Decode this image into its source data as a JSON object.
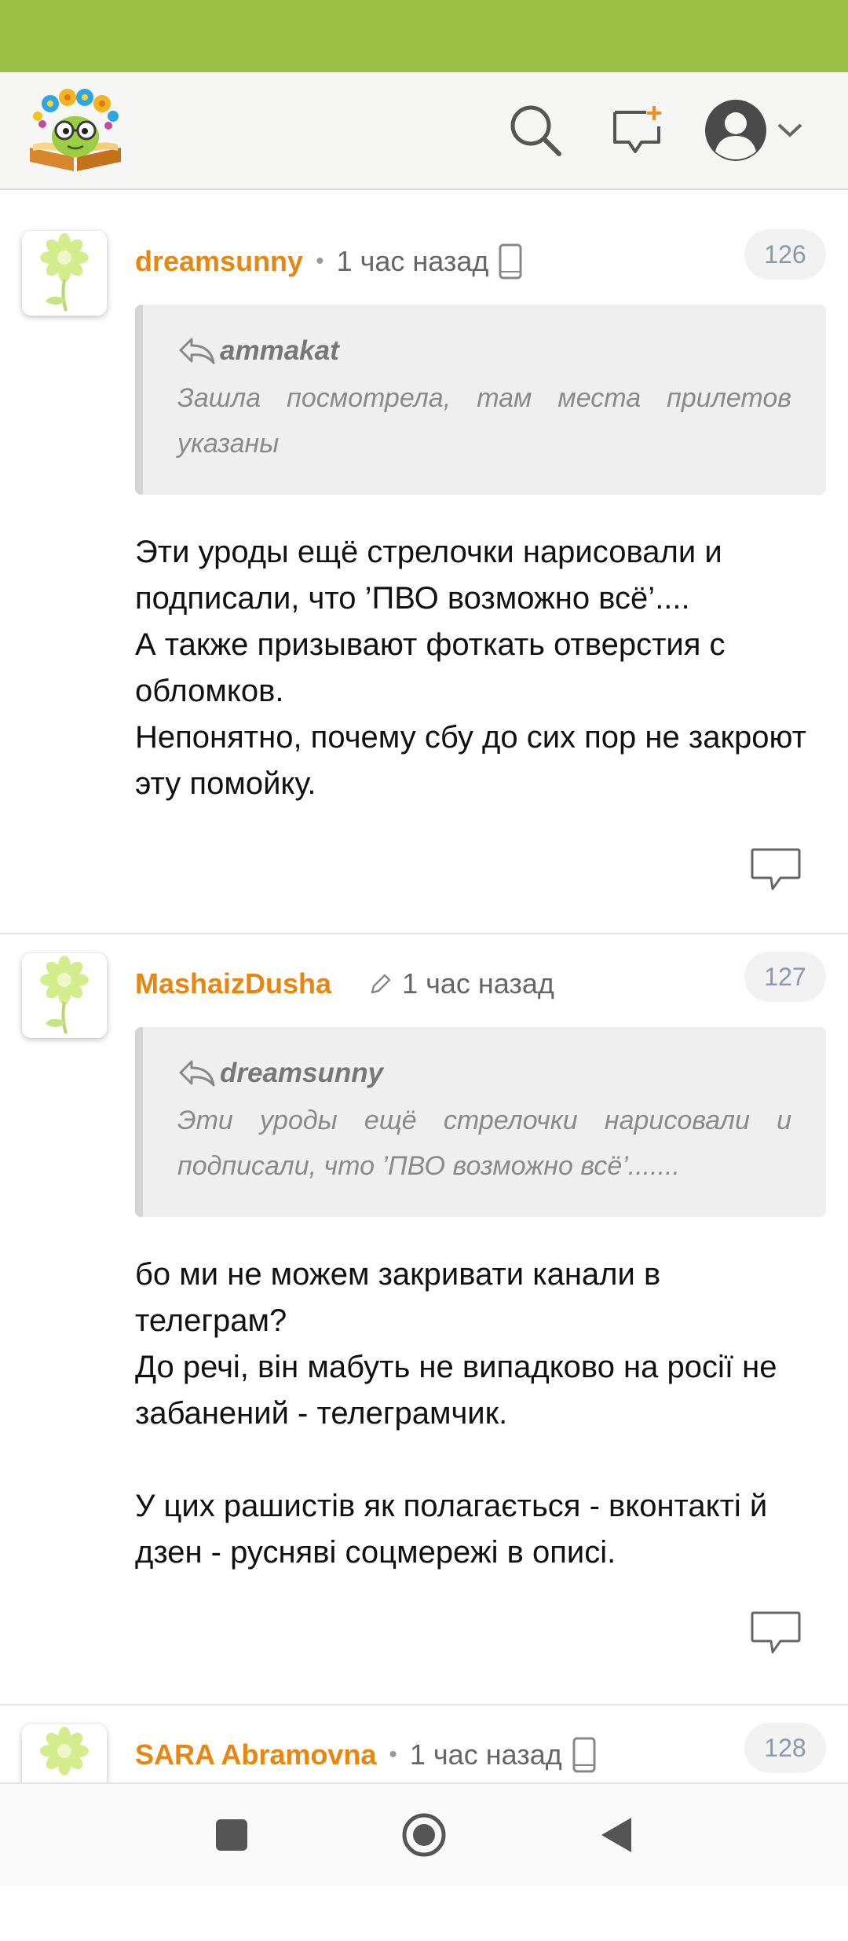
{
  "header": {
    "logo_icon": "reader-flower-logo",
    "search_icon": "search-icon",
    "new_post_icon": "new-post-icon",
    "profile_icon": "user-avatar-icon"
  },
  "comments": [
    {
      "author": "dreamsunny",
      "time": "1 час назад",
      "number": "126",
      "device_icon": "phone-icon",
      "quote": {
        "author": "ammakat",
        "text": "Зашла посмотрела, там места прилетов указаны"
      },
      "body": [
        "Эти уроды ещё стрелочки нарисовали и подписали, что ’ПВО возможно всё’....",
        "А также призывают фоткать отверстия с обломков.",
        "Непонятно, почему сбу до сих пор не закроют эту помойку."
      ]
    },
    {
      "author": "MashaizDusha",
      "time": "1 час назад",
      "number": "127",
      "edited_icon": "pencil-icon",
      "quote": {
        "author": "dreamsunny",
        "text": "Эти уроды ещё стрелочки нарисовали и подписали, что ’ПВО возможно всё’......."
      },
      "body": [
        "бо ми не можем закривати канали в телеграм?",
        "До речі, він мабуть не випадково на росії не забанений - телеграмчик.",
        "",
        "У цих рашистів як полагається - вконтакті й дзен - русняві соцмережі в описі."
      ]
    },
    {
      "author": "SARA Abramovna",
      "time": "1 час назад",
      "number": "128",
      "device_icon": "phone-icon"
    }
  ],
  "nav": {
    "recents_icon": "square-recents-icon",
    "home_icon": "circle-home-icon",
    "back_icon": "triangle-back-icon"
  },
  "colors": {
    "status_bar": "#9cc045",
    "author": "#e8860f",
    "badge_text": "#8e97a6"
  }
}
